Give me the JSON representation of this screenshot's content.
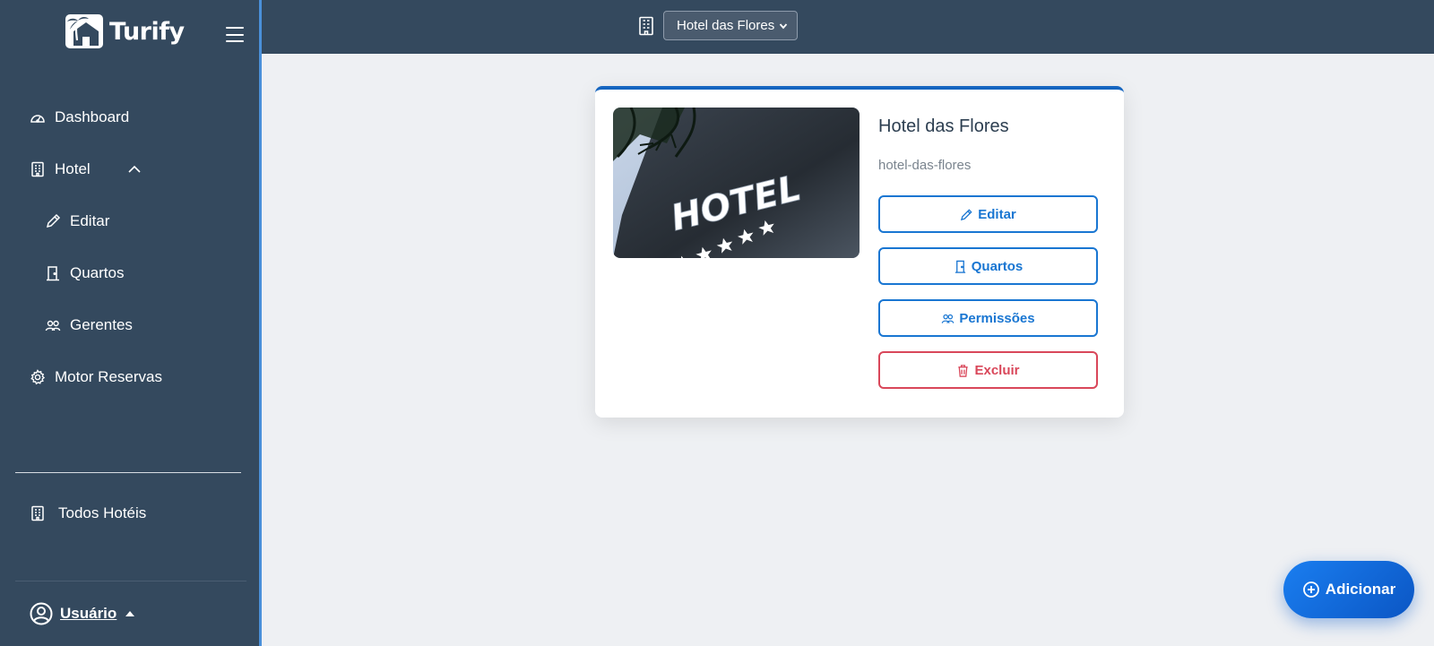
{
  "brand": {
    "name": "Turify"
  },
  "sidebar": {
    "items": [
      {
        "label": "Dashboard"
      },
      {
        "label": "Hotel"
      },
      {
        "label": "Editar"
      },
      {
        "label": "Quartos"
      },
      {
        "label": "Gerentes"
      },
      {
        "label": "Motor Reservas"
      }
    ],
    "all_hotels": "Todos Hotéis",
    "user": "Usuário"
  },
  "topbar": {
    "selected_hotel": "Hotel das Flores"
  },
  "card": {
    "title": "Hotel das Flores",
    "slug": "hotel-das-flores",
    "photo_sign": "HOTEL",
    "buttons": {
      "edit": "Editar",
      "rooms": "Quartos",
      "permissions": "Permissões",
      "delete": "Excluir"
    }
  },
  "fab": {
    "label": "Adicionar"
  },
  "colors": {
    "sidebar": "#34495e",
    "primary": "#1976d2",
    "danger": "#d9475a"
  }
}
